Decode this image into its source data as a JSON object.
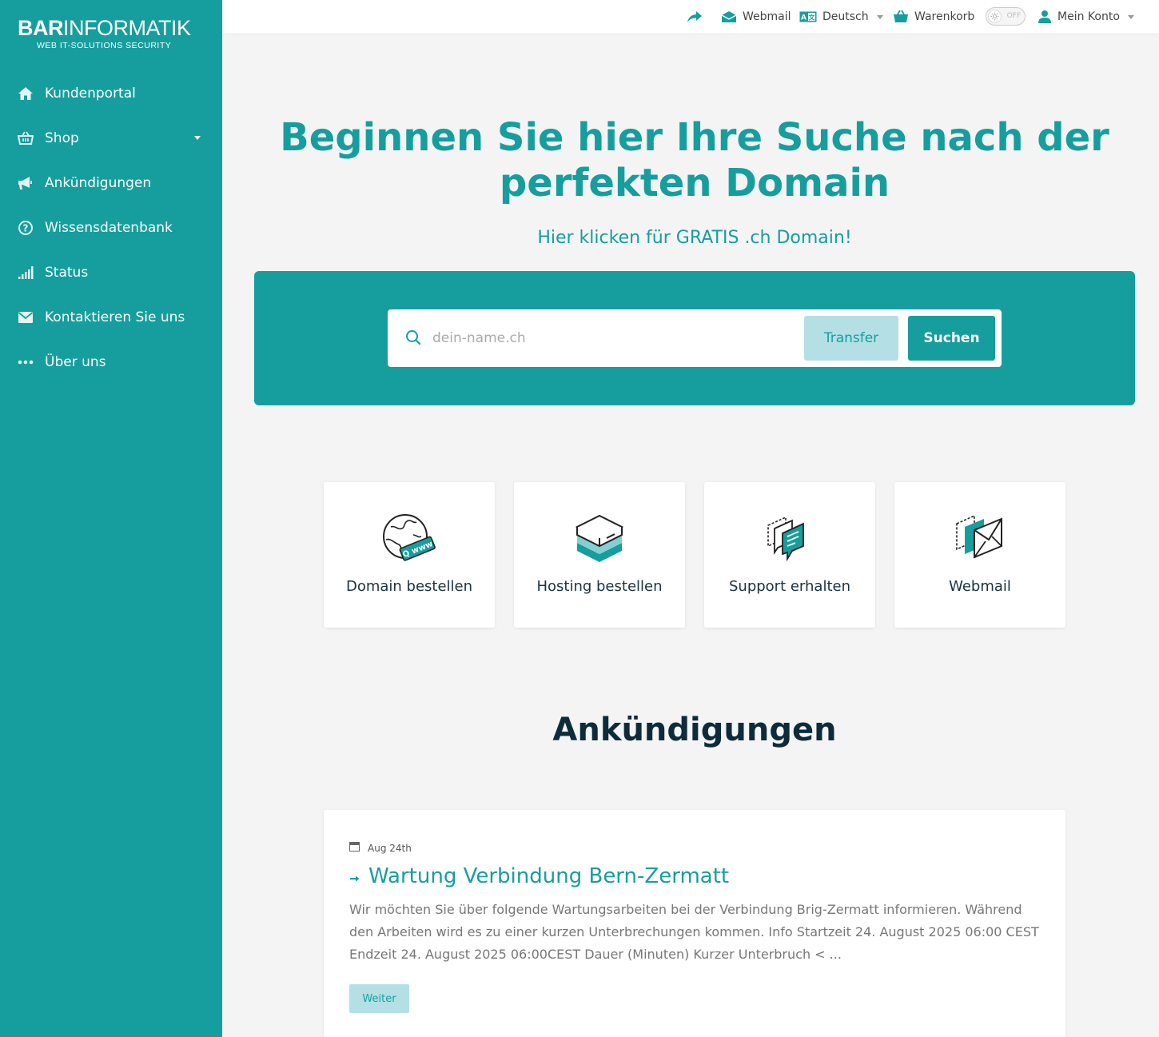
{
  "logo": {
    "bold": "BAR",
    "light": "INFORMATIK",
    "tagline": "WEB  IT-SOLUTIONS  SECURITY"
  },
  "sidebar": {
    "items": [
      {
        "label": "Kundenportal",
        "icon": "home-icon"
      },
      {
        "label": "Shop",
        "icon": "basket-icon",
        "has_dropdown": true
      },
      {
        "label": "Ankündigungen",
        "icon": "megaphone-icon"
      },
      {
        "label": "Wissensdatenbank",
        "icon": "question-circle-icon"
      },
      {
        "label": "Status",
        "icon": "signal-icon"
      },
      {
        "label": "Kontaktieren Sie uns",
        "icon": "envelope-icon"
      },
      {
        "label": "Über uns",
        "icon": "ellipsis-icon"
      }
    ]
  },
  "topbar": {
    "webmail": "Webmail",
    "language": "Deutsch",
    "cart": "Warenkorb",
    "dark_mode_toggle": "OFF",
    "account": "Mein Konto"
  },
  "hero": {
    "title": "Beginnen Sie hier Ihre Suche nach der perfekten Domain",
    "subtitle": "Hier klicken für GRATIS .ch Domain!"
  },
  "search": {
    "placeholder": "dein-name.ch",
    "transfer_label": "Transfer",
    "search_label": "Suchen"
  },
  "cards": [
    {
      "label": "Domain bestellen",
      "icon": "globe-www-icon"
    },
    {
      "label": "Hosting bestellen",
      "icon": "server-box-icon"
    },
    {
      "label": "Support erhalten",
      "icon": "chat-bubbles-icon"
    },
    {
      "label": "Webmail",
      "icon": "envelope-stack-icon"
    }
  ],
  "announcements": {
    "heading": "Ankündigungen",
    "items": [
      {
        "date": "Aug 24th",
        "title": "Wartung Verbindung Bern-Zermatt",
        "excerpt": "Wir möchten Sie über folgende Wartungsarbeiten bei der Verbindung Brig-Zermatt informieren. Während den Arbeiten wird es zu einer kurzen Unterbrechungen kommen.  Info Startzeit 24. August 2025 06:00 CEST  Endzeit 24. August 2025 06:00CEST   Dauer (Minuten) Kurzer Unterbruch < ...",
        "button": "Weiter"
      }
    ]
  },
  "colors": {
    "brand": "#169e9e",
    "brand_light": "#b4e0e5",
    "dark_text": "#0e2b3a",
    "background": "#f4f4f4"
  }
}
